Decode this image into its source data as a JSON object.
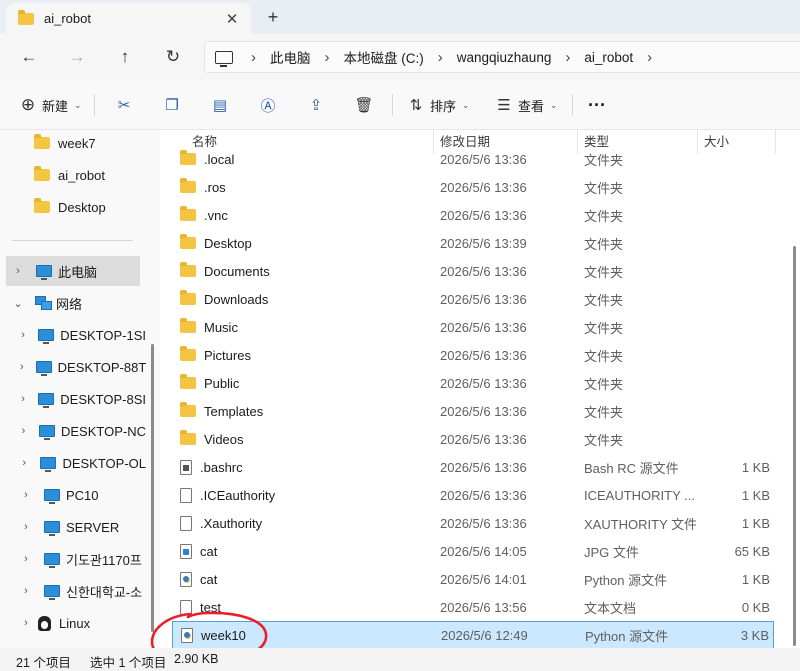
{
  "tab": {
    "title": "ai_robot",
    "close_icon": "✕",
    "new_tab_icon": "+"
  },
  "nav": {
    "back_icon": "←",
    "forward_icon": "→",
    "up_icon": "↑",
    "refresh_icon": "↻"
  },
  "breadcrumb": [
    "此电脑",
    "本地磁盘 (C:)",
    "wangqiuzhaung",
    "ai_robot"
  ],
  "commands": {
    "new_label": "新建",
    "sort_label": "排序",
    "view_label": "查看",
    "more_icon": "···"
  },
  "sidebar": {
    "quick": [
      "week7",
      "ai_robot",
      "Desktop"
    ],
    "this_pc": "此电脑",
    "network": "网络",
    "network_items": [
      "DESKTOP-1SI",
      "DESKTOP-88T",
      "DESKTOP-8SI",
      "DESKTOP-NC",
      "DESKTOP-OL",
      "PC10",
      "SERVER",
      "기도관1170프",
      "신한대학교-소"
    ],
    "linux": "Linux"
  },
  "columns": {
    "name": "名称",
    "date": "修改日期",
    "type": "类型",
    "size": "大小"
  },
  "files": [
    {
      "name": ".local",
      "date": "2026/5/6 13:36",
      "type": "文件夹",
      "size": "",
      "icon": "folder"
    },
    {
      "name": ".ros",
      "date": "2026/5/6 13:36",
      "type": "文件夹",
      "size": "",
      "icon": "folder"
    },
    {
      "name": ".vnc",
      "date": "2026/5/6 13:36",
      "type": "文件夹",
      "size": "",
      "icon": "folder"
    },
    {
      "name": "Desktop",
      "date": "2026/5/6 13:39",
      "type": "文件夹",
      "size": "",
      "icon": "folder"
    },
    {
      "name": "Documents",
      "date": "2026/5/6 13:36",
      "type": "文件夹",
      "size": "",
      "icon": "folder"
    },
    {
      "name": "Downloads",
      "date": "2026/5/6 13:36",
      "type": "文件夹",
      "size": "",
      "icon": "folder"
    },
    {
      "name": "Music",
      "date": "2026/5/6 13:36",
      "type": "文件夹",
      "size": "",
      "icon": "folder"
    },
    {
      "name": "Pictures",
      "date": "2026/5/6 13:36",
      "type": "文件夹",
      "size": "",
      "icon": "folder"
    },
    {
      "name": "Public",
      "date": "2026/5/6 13:36",
      "type": "文件夹",
      "size": "",
      "icon": "folder"
    },
    {
      "name": "Templates",
      "date": "2026/5/6 13:36",
      "type": "文件夹",
      "size": "",
      "icon": "folder"
    },
    {
      "name": "Videos",
      "date": "2026/5/6 13:36",
      "type": "文件夹",
      "size": "",
      "icon": "folder"
    },
    {
      "name": ".bashrc",
      "date": "2026/5/6 13:36",
      "type": "Bash RC 源文件",
      "size": "1 KB",
      "icon": "file-dark"
    },
    {
      "name": ".ICEauthority",
      "date": "2026/5/6 13:36",
      "type": "ICEAUTHORITY ...",
      "size": "1 KB",
      "icon": "file"
    },
    {
      "name": ".Xauthority",
      "date": "2026/5/6 13:36",
      "type": "XAUTHORITY 文件",
      "size": "1 KB",
      "icon": "file"
    },
    {
      "name": "cat",
      "date": "2026/5/6 14:05",
      "type": "JPG 文件",
      "size": "65 KB",
      "icon": "file-jpg"
    },
    {
      "name": "cat",
      "date": "2026/5/6 14:01",
      "type": "Python 源文件",
      "size": "1 KB",
      "icon": "file-py"
    },
    {
      "name": "test",
      "date": "2026/5/6 13:56",
      "type": "文本文档",
      "size": "0 KB",
      "icon": "file"
    },
    {
      "name": "week10",
      "date": "2026/5/6 12:49",
      "type": "Python 源文件",
      "size": "3 KB",
      "icon": "file-py",
      "selected": true
    }
  ],
  "status": {
    "count": "21 个项目",
    "selected": "选中 1 个项目",
    "size": "2.90 KB"
  },
  "colors": {
    "selection_bg": "#cce8ff",
    "selection_border": "#5a9fd4",
    "annotation": "#e8202a",
    "folder": "#f4c542"
  }
}
